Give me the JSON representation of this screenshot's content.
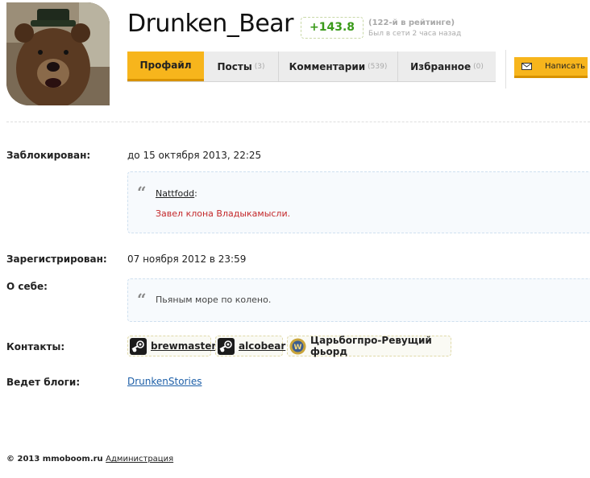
{
  "profile": {
    "username": "Drunken_Bear",
    "rating": "+143.8",
    "rank": "(122-й в рейтинге)",
    "last_seen": "Был в сети 2 часа назад"
  },
  "tabs": [
    {
      "label": "Профайл",
      "count": ""
    },
    {
      "label": "Посты",
      "count": "(3)"
    },
    {
      "label": "Комментарии",
      "count": "(539)"
    },
    {
      "label": "Избранное",
      "count": "(0)"
    }
  ],
  "write_button": {
    "label": "Написать"
  },
  "fields": {
    "blocked_label": "Заблокирован:",
    "blocked_value": "до 15 октября 2013, 22:25",
    "block_quote": {
      "author": "Nattfodd",
      "text": "Завел клона Владыкамысли."
    },
    "registered_label": "Зарегистрирован:",
    "registered_value": "07 ноября 2012 в 23:59",
    "about_label": "О себе:",
    "about_text": "Пьяным море по колено.",
    "contacts_label": "Контакты:",
    "contacts": [
      {
        "name": "brewmaster",
        "icon": "steam-icon"
      },
      {
        "name": "alcobear",
        "icon": "steam-icon"
      },
      {
        "name": "Царьбогпро-Ревущий фьорд",
        "icon": "wow-icon"
      }
    ],
    "blogs_label": "Ведет блоги:",
    "blog": "DrunkenStories"
  },
  "footer": {
    "copyright": "© 2013 mmoboom.ru",
    "admin_link": "Администрация"
  },
  "colors": {
    "accent": "#f7b51c",
    "rating_green": "#3a9a1a",
    "quote_red": "#c4282a",
    "link": "#1d5fa8"
  }
}
